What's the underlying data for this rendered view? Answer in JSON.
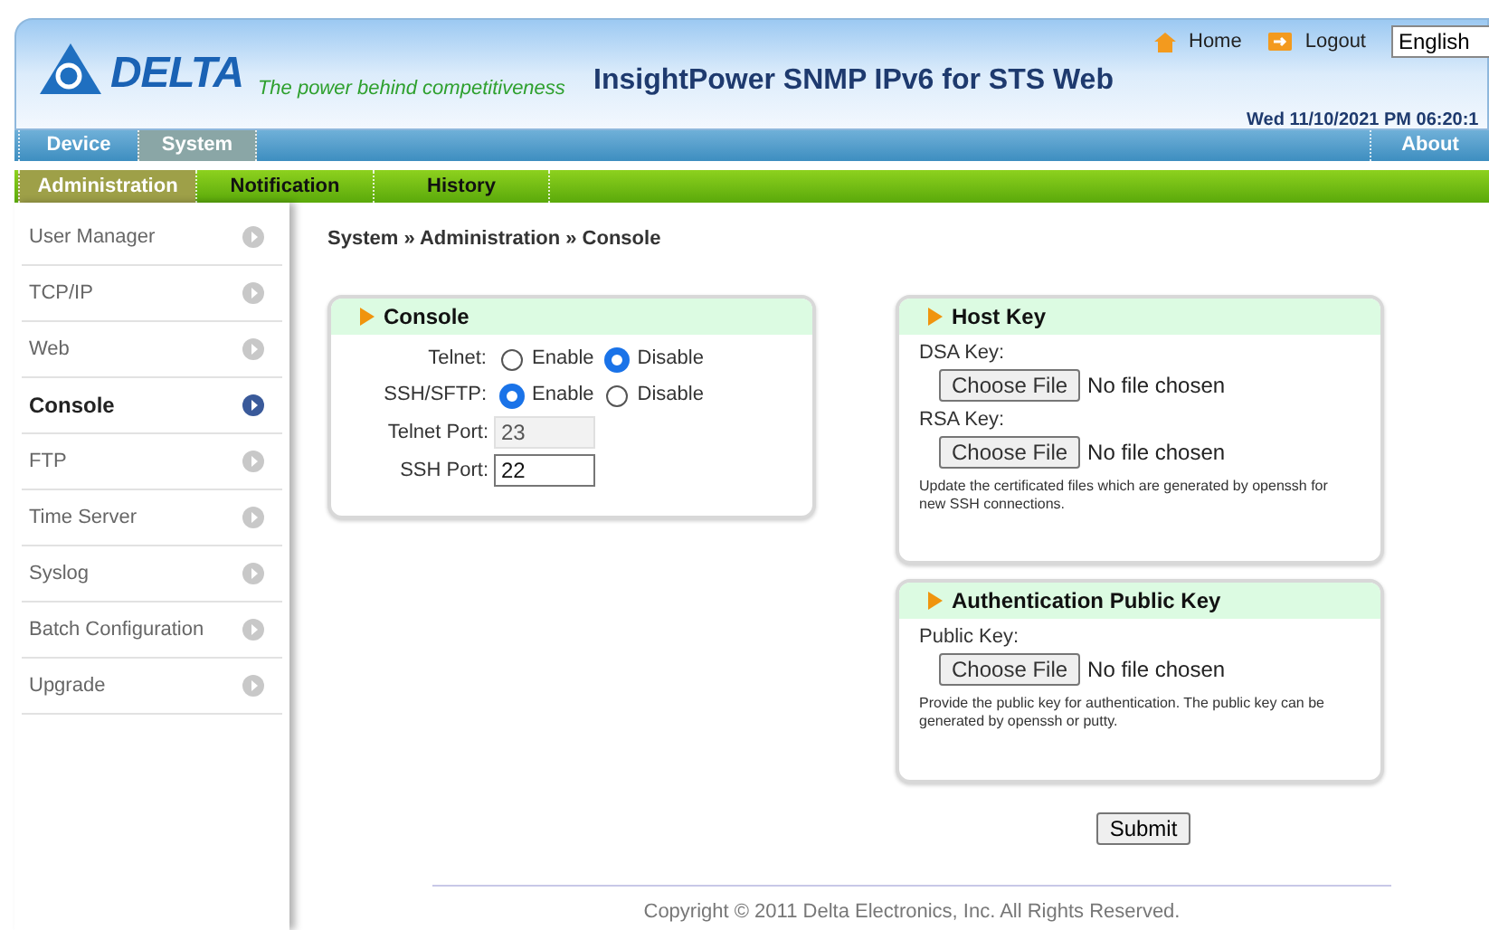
{
  "header": {
    "logo_text": "DELTA",
    "tagline": "The power behind competitiveness",
    "title": "InsightPower SNMP IPv6 for STS Web",
    "links": [
      {
        "kind": "home",
        "label": "Home"
      },
      {
        "kind": "logout",
        "label": "Logout"
      }
    ],
    "language": "English",
    "datetime": "Wed 11/10/2021 PM 06:20:1"
  },
  "main_nav": [
    {
      "label": "Device",
      "selected": false
    },
    {
      "label": "System",
      "selected": true
    }
  ],
  "main_nav_right": "About",
  "sub_nav": [
    {
      "label": "Administration",
      "selected": true
    },
    {
      "label": "Notification",
      "selected": false
    },
    {
      "label": "History",
      "selected": false
    }
  ],
  "sidebar": [
    {
      "label": "User Manager",
      "selected": false
    },
    {
      "label": "TCP/IP",
      "selected": false
    },
    {
      "label": "Web",
      "selected": false
    },
    {
      "label": "Console",
      "selected": true
    },
    {
      "label": "FTP",
      "selected": false
    },
    {
      "label": "Time Server",
      "selected": false
    },
    {
      "label": "Syslog",
      "selected": false
    },
    {
      "label": "Batch Configuration",
      "selected": false
    },
    {
      "label": "Upgrade",
      "selected": false
    }
  ],
  "breadcrumb": "System » Administration » Console",
  "console": {
    "title": "Console",
    "radios": [
      {
        "label": "Telnet:",
        "options": [
          {
            "label": "Enable",
            "selected": false
          },
          {
            "label": "Disable",
            "selected": true
          }
        ]
      },
      {
        "label": "SSH/SFTP:",
        "options": [
          {
            "label": "Enable",
            "selected": true
          },
          {
            "label": "Disable",
            "selected": false
          }
        ]
      }
    ],
    "fields": [
      {
        "label": "Telnet Port:",
        "value": "23",
        "disabled": true
      },
      {
        "label": "SSH Port:",
        "value": "22",
        "disabled": false
      }
    ]
  },
  "host_key": {
    "title": "Host Key",
    "files": [
      {
        "label": "DSA Key:",
        "button": "Choose File",
        "status": "No file chosen"
      },
      {
        "label": "RSA Key:",
        "button": "Choose File",
        "status": "No file chosen"
      }
    ],
    "note": "Update the certificated files which are generated by openssh for new SSH connections."
  },
  "auth_key": {
    "title": "Authentication Public Key",
    "files": [
      {
        "label": "Public Key:",
        "button": "Choose File",
        "status": "No file chosen"
      }
    ],
    "note": "Provide the public key for authentication. The public key can be generated by openssh or putty."
  },
  "submit": "Submit",
  "footer": "Copyright © 2011 Delta Electronics, Inc. All Rights Reserved."
}
